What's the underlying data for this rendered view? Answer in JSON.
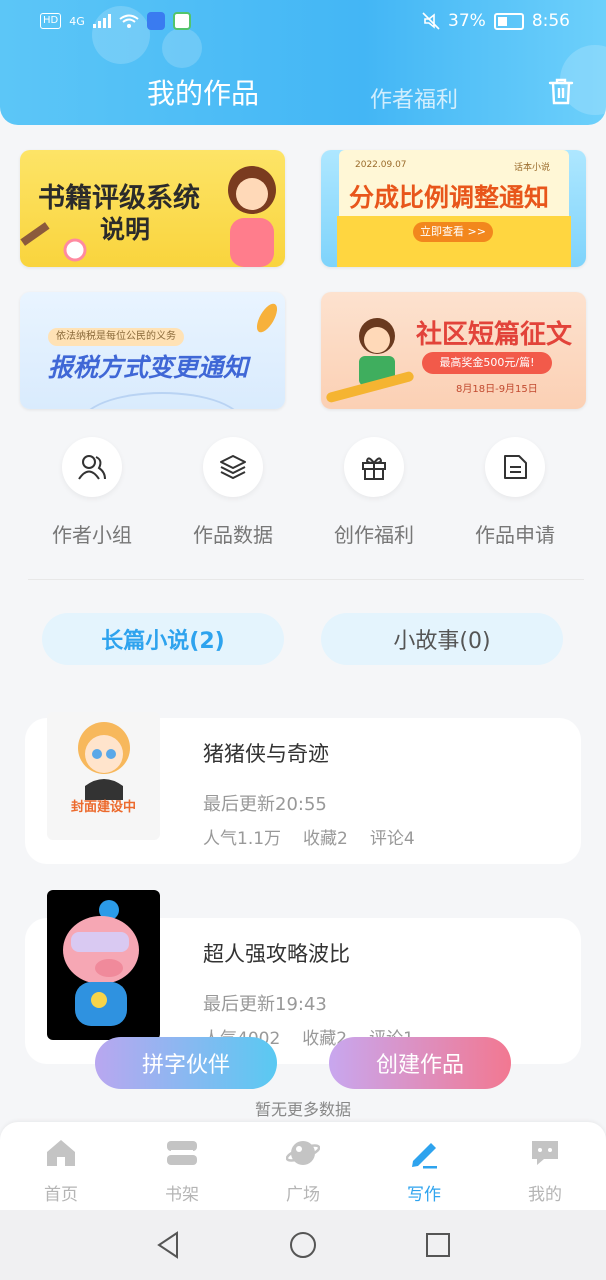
{
  "status_bar": {
    "network_chip": "HD",
    "signal_label": "4G",
    "battery_percent": "37%",
    "time": "8:56"
  },
  "header": {
    "active_tab": "我的作品",
    "inactive_tab": "作者福利",
    "trash_icon": "trash-icon"
  },
  "banners": [
    {
      "title_line1": "书籍评级系统",
      "title_line2": "说明",
      "color": "#f9d43d"
    },
    {
      "small_date": "2022.09.07",
      "small_tag": "话本小说",
      "title": "分成比例调整通知",
      "button": "立即查看 >>"
    },
    {
      "small_text": "依法纳税是每位公民的义务",
      "title": "报税方式变更通知"
    },
    {
      "title": "社区短篇征文",
      "prize": "最高奖金500元/篇!",
      "dates": "8月18日-9月15日"
    }
  ],
  "quick_actions": [
    {
      "label": "作者小组",
      "icon": "author-group-icon"
    },
    {
      "label": "作品数据",
      "icon": "layers-icon"
    },
    {
      "label": "创作福利",
      "icon": "gift-icon"
    },
    {
      "label": "作品申请",
      "icon": "document-icon"
    }
  ],
  "type_tabs": {
    "long": "长篇小说(2)",
    "short": "小故事(0)"
  },
  "works": [
    {
      "title": "猪猪侠与奇迹",
      "cover_caption": "封面建设中",
      "updated": "最后更新20:55",
      "popularity": "人气1.1万",
      "favorites": "收藏2",
      "comments": "评论4"
    },
    {
      "title": "超人强攻略波比",
      "updated": "最后更新19:43",
      "popularity": "人气4002",
      "favorites": "收藏2",
      "comments": "评论1"
    }
  ],
  "floating": {
    "partner": "拼字伙伴",
    "create": "创建作品",
    "no_more": "暂无更多数据"
  },
  "bottom_nav": [
    {
      "label": "首页",
      "icon": "home-icon"
    },
    {
      "label": "书架",
      "icon": "bookshelf-icon"
    },
    {
      "label": "广场",
      "icon": "planet-icon"
    },
    {
      "label": "写作",
      "icon": "pen-icon"
    },
    {
      "label": "我的",
      "icon": "chat-bubble-icon"
    }
  ],
  "colors": {
    "accent": "#2ea3ee",
    "header": "#43b6f5"
  }
}
